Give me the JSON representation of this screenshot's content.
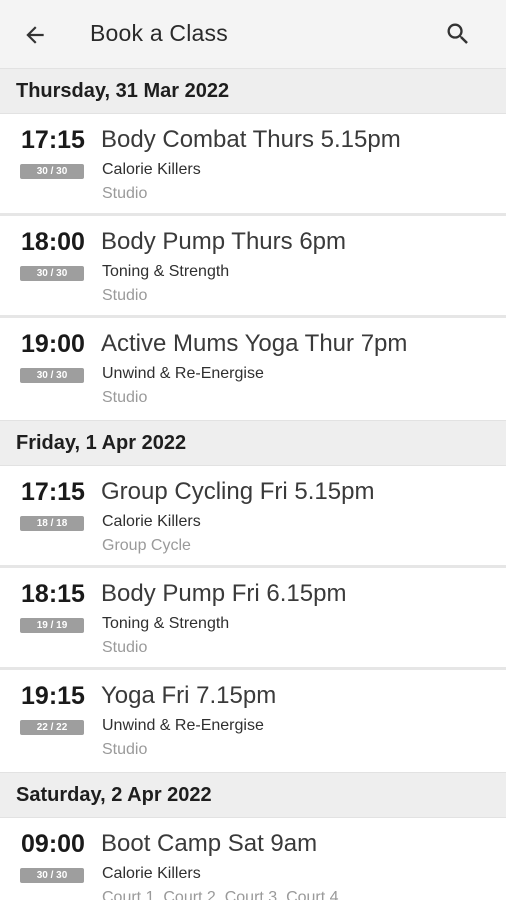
{
  "appbar": {
    "title": "Book a Class",
    "back_icon": "arrow-left-icon",
    "search_icon": "search-icon"
  },
  "days": [
    {
      "date": "Thursday, 31 Mar 2022",
      "classes": [
        {
          "time": "17:15",
          "capacity": "30 / 30",
          "name": "Body Combat Thurs 5.15pm",
          "category": "Calorie Killers",
          "location": "Studio"
        },
        {
          "time": "18:00",
          "capacity": "30 / 30",
          "name": "Body Pump Thurs 6pm",
          "category": "Toning & Strength",
          "location": "Studio"
        },
        {
          "time": "19:00",
          "capacity": "30 / 30",
          "name": "Active Mums Yoga Thur 7pm",
          "category": "Unwind & Re-Energise",
          "location": "Studio"
        }
      ]
    },
    {
      "date": "Friday, 1 Apr 2022",
      "classes": [
        {
          "time": "17:15",
          "capacity": "18 / 18",
          "name": "Group Cycling Fri 5.15pm",
          "category": "Calorie Killers",
          "location": "Group Cycle"
        },
        {
          "time": "18:15",
          "capacity": "19 / 19",
          "name": "Body Pump Fri 6.15pm",
          "category": "Toning & Strength",
          "location": "Studio"
        },
        {
          "time": "19:15",
          "capacity": "22 / 22",
          "name": "Yoga Fri 7.15pm",
          "category": "Unwind & Re-Energise",
          "location": "Studio"
        }
      ]
    },
    {
      "date": "Saturday, 2 Apr 2022",
      "classes": [
        {
          "time": "09:00",
          "capacity": "30 / 30",
          "name": "Boot Camp Sat 9am",
          "category": "Calorie Killers",
          "location": "Court 1, Court 2, Court 3, Court 4"
        }
      ]
    }
  ],
  "colors": {
    "appbar_bg": "#f4f4f4",
    "day_header_bg": "#eeeeee",
    "badge_bg": "#9e9e9e",
    "location_text": "#9a9a9a"
  }
}
